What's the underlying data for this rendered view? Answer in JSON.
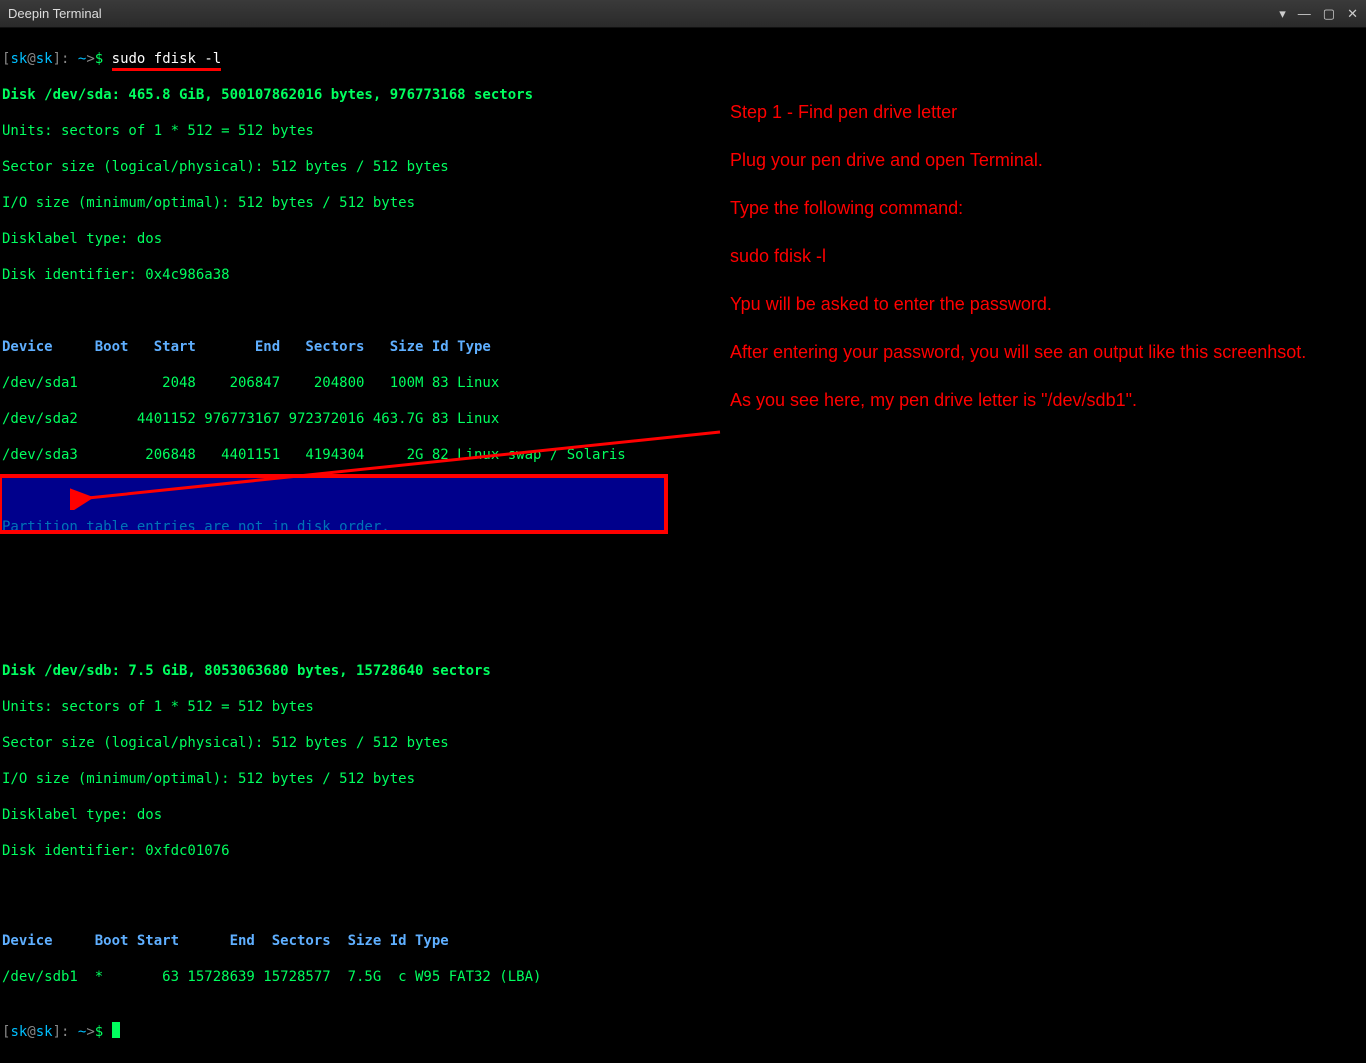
{
  "window": {
    "title": "Deepin Terminal"
  },
  "prompt": {
    "user": "sk",
    "host": "sk",
    "path": "~",
    "symbol": "$",
    "command": "sudo fdisk -l"
  },
  "disk_sda": {
    "header": "Disk /dev/sda: 465.8 GiB, 500107862016 bytes, 976773168 sectors",
    "units": "Units: sectors of 1 * 512 = 512 bytes",
    "sector": "Sector size (logical/physical): 512 bytes / 512 bytes",
    "io": "I/O size (minimum/optimal): 512 bytes / 512 bytes",
    "label": "Disklabel type: dos",
    "ident": "Disk identifier: 0x4c986a38"
  },
  "table_sda": {
    "header": "Device     Boot   Start       End   Sectors   Size Id Type",
    "rows": [
      "/dev/sda1          2048    206847    204800   100M 83 Linux",
      "/dev/sda2       4401152 976773167 972372016 463.7G 83 Linux",
      "/dev/sda3        206848   4401151   4194304     2G 82 Linux swap / Solaris"
    ]
  },
  "warn": "Partition table entries are not in disk order.",
  "disk_sdb": {
    "header": "Disk /dev/sdb: 7.5 GiB, 8053063680 bytes, 15728640 sectors",
    "units": "Units: sectors of 1 * 512 = 512 bytes",
    "sector": "Sector size (logical/physical): 512 bytes / 512 bytes",
    "io": "I/O size (minimum/optimal): 512 bytes / 512 bytes",
    "label": "Disklabel type: dos",
    "ident": "Disk identifier: 0xfdc01076"
  },
  "table_sdb": {
    "header": "Device     Boot Start      End  Sectors  Size Id Type",
    "row": "/dev/sdb1  *       63 15728639 15728577  7.5G  c W95 FAT32 (LBA)"
  },
  "annot": {
    "step": "Step 1 - Find pen drive letter",
    "plug": "Plug your pen drive and open Terminal.",
    "type": "Type the following command:",
    "cmd": "sudo fdisk -l",
    "pw": "Ypu will be asked to enter the password.",
    "after": "After entering your password, you will see an output like this screenhsot.",
    "see": "As you see here, my pen drive letter is \"/dev/sdb1\"."
  }
}
